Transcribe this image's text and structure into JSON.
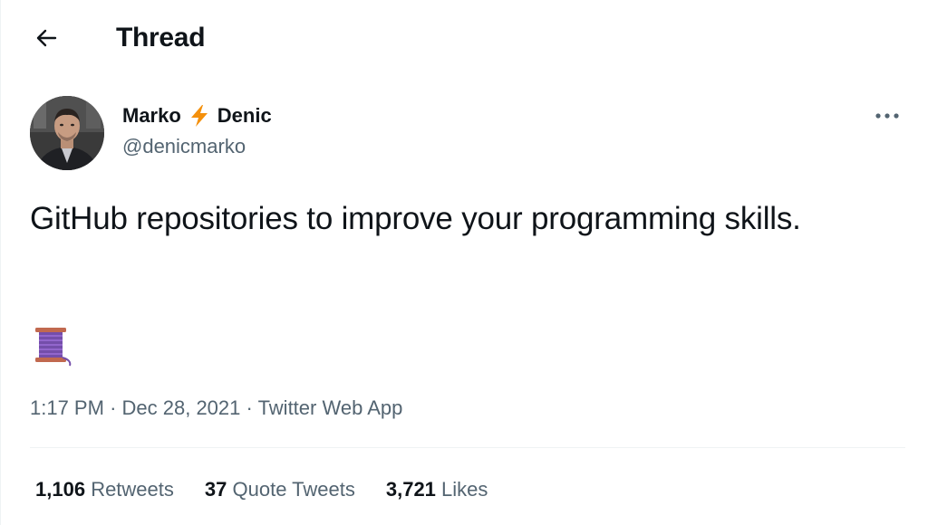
{
  "header": {
    "title": "Thread",
    "back_icon": "arrow-left-icon"
  },
  "author": {
    "first_name": "Marko",
    "emoji": "⚡",
    "last_name": "Denic",
    "handle": "@denicmarko"
  },
  "tweet": {
    "text": "GitHub repositories to improve your programming skills.",
    "thread_emoji": "🧵",
    "time": "1:17 PM",
    "separator": "·",
    "date": "Dec 28, 2021",
    "source": "Twitter Web App"
  },
  "stats": [
    {
      "count": "1,106",
      "label": "Retweets"
    },
    {
      "count": "37",
      "label": "Quote Tweets"
    },
    {
      "count": "3,721",
      "label": "Likes"
    }
  ],
  "colors": {
    "text_primary": "#0f1419",
    "text_secondary": "#536471",
    "divider": "#eff3f4",
    "bolt": "#f4900c"
  }
}
